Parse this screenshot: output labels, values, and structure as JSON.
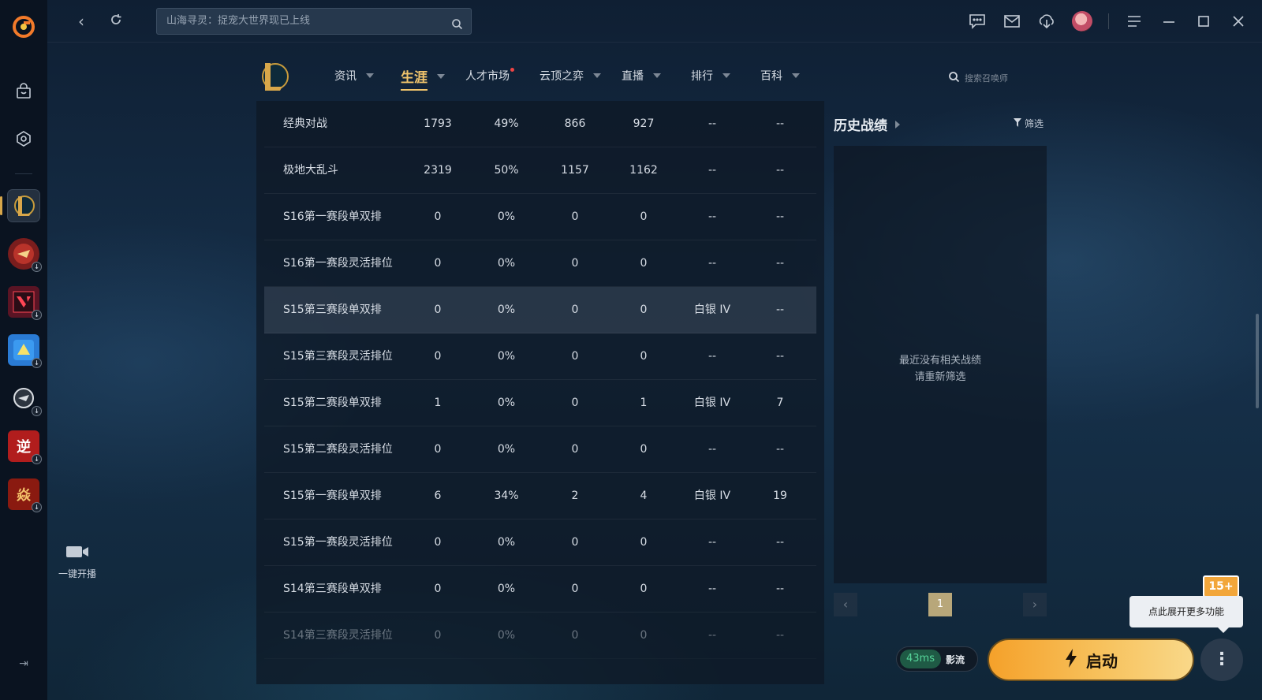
{
  "top": {
    "search_placeholder": "山海寻灵：捉宠大世界现已上线"
  },
  "subnav": {
    "tabs": [
      {
        "label": "资讯"
      },
      {
        "label": "生涯"
      },
      {
        "label": "人才市场"
      },
      {
        "label": "云顶之弈"
      },
      {
        "label": "直播"
      },
      {
        "label": "排行"
      },
      {
        "label": "百科"
      }
    ],
    "search_label": "搜索召唤师"
  },
  "table": {
    "rows": [
      [
        "经典对战",
        "1793",
        "49%",
        "866",
        "927",
        "--",
        "--"
      ],
      [
        "极地大乱斗",
        "2319",
        "50%",
        "1157",
        "1162",
        "--",
        "--"
      ],
      [
        "S16第一赛段单双排",
        "0",
        "0%",
        "0",
        "0",
        "--",
        "--"
      ],
      [
        "S16第一赛段灵活排位",
        "0",
        "0%",
        "0",
        "0",
        "--",
        "--"
      ],
      [
        "S15第三赛段单双排",
        "0",
        "0%",
        "0",
        "0",
        "白银 IV",
        "--"
      ],
      [
        "S15第三赛段灵活排位",
        "0",
        "0%",
        "0",
        "0",
        "--",
        "--"
      ],
      [
        "S15第二赛段单双排",
        "1",
        "0%",
        "0",
        "1",
        "白银 IV",
        "7"
      ],
      [
        "S15第二赛段灵活排位",
        "0",
        "0%",
        "0",
        "0",
        "--",
        "--"
      ],
      [
        "S15第一赛段单双排",
        "6",
        "34%",
        "2",
        "4",
        "白银 IV",
        "19"
      ],
      [
        "S15第一赛段灵活排位",
        "0",
        "0%",
        "0",
        "0",
        "--",
        "--"
      ],
      [
        "S14第三赛段单双排",
        "0",
        "0%",
        "0",
        "0",
        "--",
        "--"
      ],
      [
        "S14第三赛段灵活排位",
        "0",
        "0%",
        "0",
        "0",
        "--",
        "--"
      ]
    ]
  },
  "history": {
    "title": "历史战绩",
    "filter_label": "筛选",
    "empty_line1": "最近没有相关战绩",
    "empty_line2": "请重新筛选",
    "page": "1"
  },
  "live": {
    "label": "一键开播"
  },
  "launcher": {
    "ping": "43ms",
    "accel_label": "影流",
    "launch_label": "启动",
    "tooltip": "点此展开更多功能",
    "age_badge": "15+"
  },
  "colors": {
    "accent_gold": "#f0c46c",
    "launch_orange": "#f5a12a",
    "ping_green": "#56d59a"
  }
}
